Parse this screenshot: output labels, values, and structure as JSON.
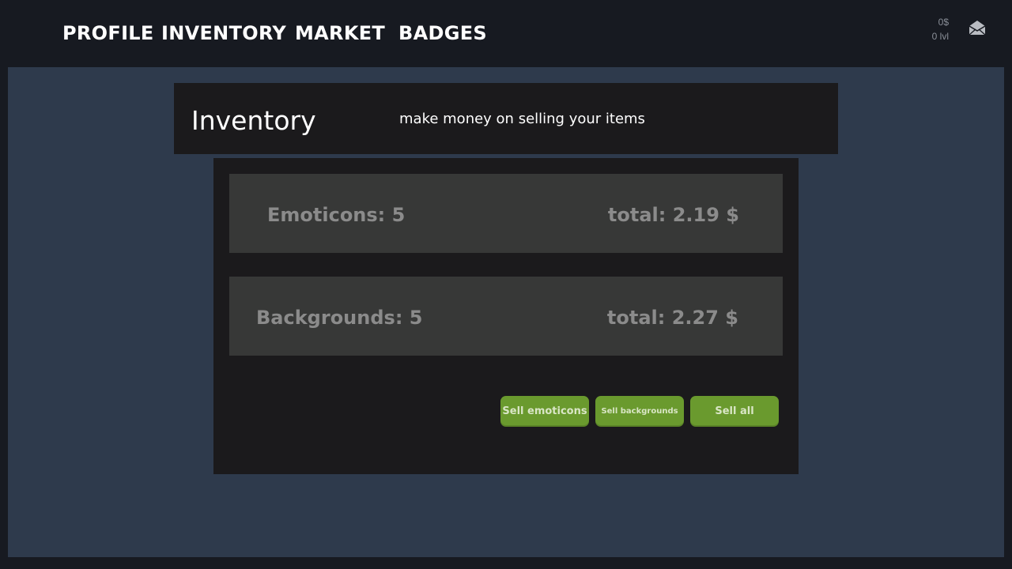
{
  "nav": {
    "items": [
      {
        "label": "PROFILE"
      },
      {
        "label": "INVENTORY"
      },
      {
        "label": "MARKET"
      },
      {
        "label": "BADGES"
      }
    ]
  },
  "wallet": {
    "balance": "0$",
    "level": "0 lvl"
  },
  "icons": {
    "mail": "envelope-icon"
  },
  "header": {
    "title": "Inventory",
    "subtitle": "make money on selling your items"
  },
  "inventory": {
    "rows": [
      {
        "label": "Emoticons: 5",
        "total": "total: 2.19 $"
      },
      {
        "label": "Backgrounds: 5",
        "total": "total: 2.27 $"
      }
    ]
  },
  "actions": {
    "sell_emoticons": "Sell emoticons",
    "sell_backgrounds": "Sell backgrounds",
    "sell_all": "Sell all"
  },
  "colors": {
    "topbar": "#171a21",
    "content_bg": "#2e3a4c",
    "card_bg": "#1b1a1c",
    "row_bg": "#373837",
    "button_green": "#6a9a2e"
  }
}
